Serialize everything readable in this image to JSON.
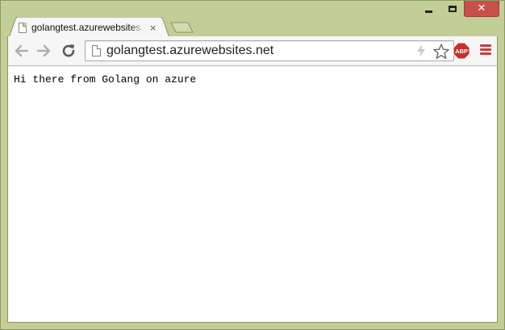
{
  "window": {
    "minimize_icon": "minimize-icon",
    "maximize_icon": "maximize-icon",
    "close_icon": "close-icon",
    "close_glyph": "✕",
    "frame_color": "#c3cd96",
    "close_color": "#c7504b"
  },
  "tabs": [
    {
      "title": "golangtest.azurewebsites.net",
      "close_glyph": "×",
      "active": true
    }
  ],
  "toolbar": {
    "back_icon": "back-arrow-icon",
    "forward_icon": "forward-arrow-icon",
    "reload_icon": "reload-icon",
    "omnibox": {
      "url": "golangtest.azurewebsites.net",
      "page_icon": "page-icon",
      "lightning_icon": "lightning-icon",
      "bookmark_icon": "bookmark-star-icon"
    },
    "extension": {
      "label": "ABP",
      "icon": "adblock-plus-icon",
      "color": "#c7302d"
    },
    "menu_icon": "hamburger-menu-icon",
    "menu_color": "#d23a3a"
  },
  "page": {
    "text": "Hi there from Golang on azure"
  }
}
